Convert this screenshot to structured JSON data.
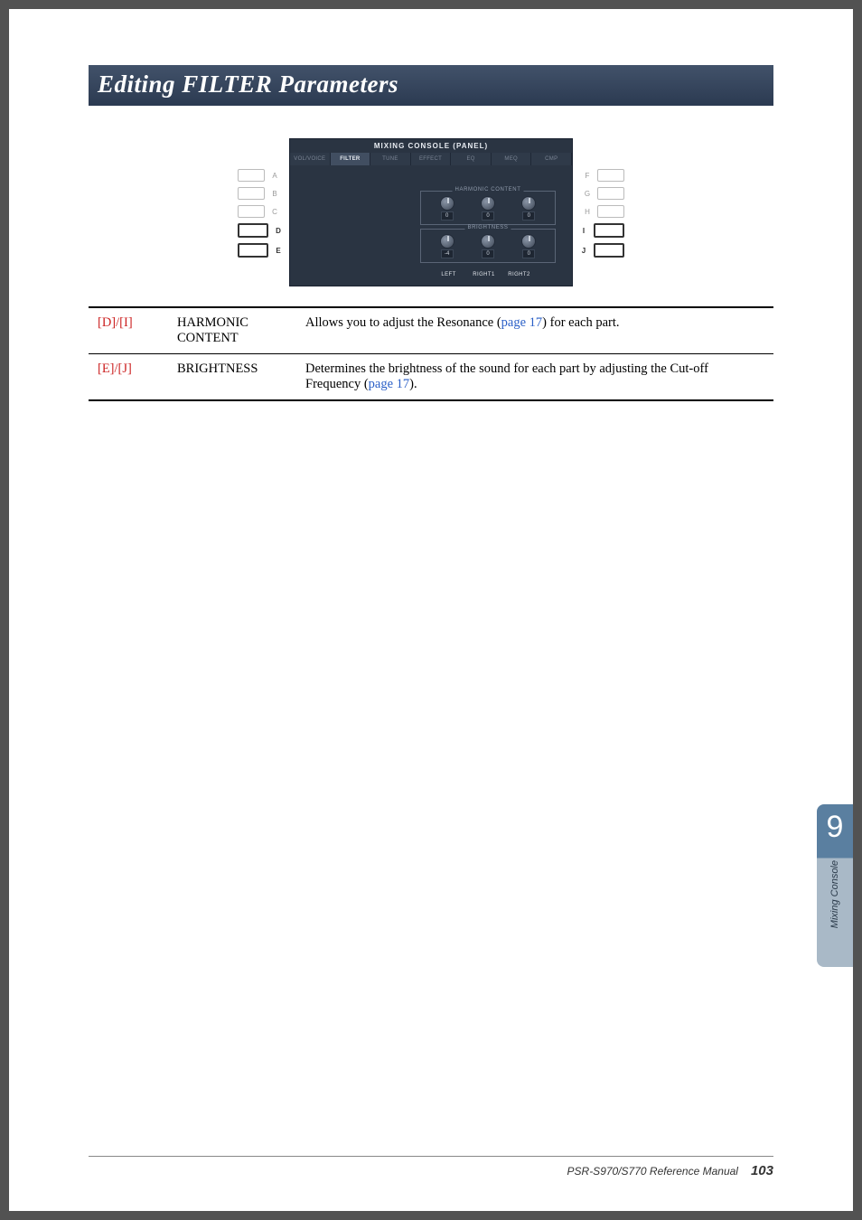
{
  "title": "Editing FILTER Parameters",
  "figure": {
    "screen_title": "MIXING CONSOLE (PANEL)",
    "tabs": [
      "VOL/VOICE",
      "FILTER",
      "TUNE",
      "EFFECT",
      "EQ",
      "MEQ",
      "CMP"
    ],
    "active_tab_index": 1,
    "left_buttons": [
      "A",
      "B",
      "C",
      "D",
      "E"
    ],
    "right_buttons": [
      "F",
      "G",
      "H",
      "I",
      "J"
    ],
    "active_left": [
      "D",
      "E"
    ],
    "active_right": [
      "I",
      "J"
    ],
    "group1": {
      "title": "HARMONIC CONTENT",
      "values": [
        "0",
        "0",
        "0"
      ]
    },
    "group2": {
      "title": "BRIGHTNESS",
      "values": [
        "-4",
        "0",
        "0"
      ]
    },
    "bottom_labels": [
      "",
      "",
      "",
      "",
      "LEFT",
      "RIGHT1",
      "RIGHT2",
      ""
    ]
  },
  "table": {
    "rows": [
      {
        "key": "[D]/[I]",
        "name": "HARMONIC CONTENT",
        "desc_pre": "Allows you to adjust the Resonance (",
        "link": "page 17",
        "desc_post": ") for each part."
      },
      {
        "key": "[E]/[J]",
        "name": "BRIGHTNESS",
        "desc_pre": "Determines the brightness of the sound for each part by adjusting the Cut-off Frequency (",
        "link": "page 17",
        "desc_post": ")."
      }
    ]
  },
  "side_tab": {
    "number": "9",
    "label": "Mixing Console"
  },
  "footer": {
    "model": "PSR-S970/S770 Reference Manual",
    "page": "103"
  }
}
